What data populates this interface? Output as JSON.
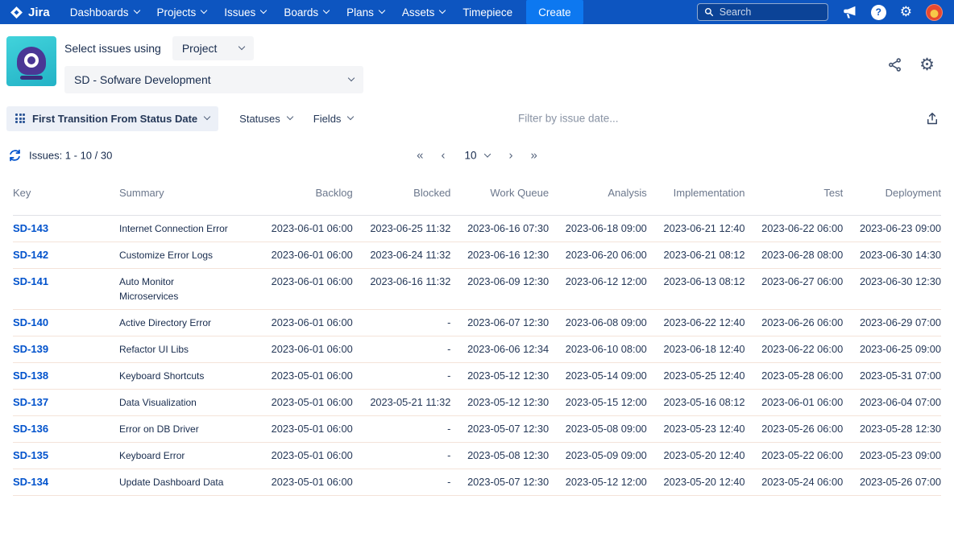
{
  "nav": {
    "brand": "Jira",
    "items": [
      {
        "label": "Dashboards",
        "chevron": true
      },
      {
        "label": "Projects",
        "chevron": true
      },
      {
        "label": "Issues",
        "chevron": true
      },
      {
        "label": "Boards",
        "chevron": true
      },
      {
        "label": "Plans",
        "chevron": true
      },
      {
        "label": "Assets",
        "chevron": true
      },
      {
        "label": "Timepiece",
        "chevron": false
      }
    ],
    "create_label": "Create",
    "search_placeholder": "Search"
  },
  "gadget_header": {
    "select_issues_label": "Select issues using",
    "issue_source_value": "Project",
    "project_value": "SD - Sofware Development"
  },
  "toolbar": {
    "column_mode_label": "First Transition From Status Date",
    "statuses_label": "Statuses",
    "fields_label": "Fields",
    "filter_placeholder": "Filter by issue date..."
  },
  "pagination": {
    "issues_summary": "Issues: 1 - 10 / 30",
    "page_size": "10",
    "first_label": "«",
    "prev_label": "‹",
    "next_label": "›",
    "last_label": "»"
  },
  "table": {
    "columns": [
      "Key",
      "Summary",
      "Backlog",
      "Blocked",
      "Work Queue",
      "Analysis",
      "Implementation",
      "Test",
      "Deployment"
    ],
    "rows": [
      {
        "key": "SD-143",
        "summary": "Internet Connection Error",
        "dates": [
          "2023-06-01 06:00",
          "2023-06-25 11:32",
          "2023-06-16 07:30",
          "2023-06-18 09:00",
          "2023-06-21 12:40",
          "2023-06-22 06:00",
          "2023-06-23 09:00"
        ]
      },
      {
        "key": "SD-142",
        "summary": "Customize Error Logs",
        "dates": [
          "2023-06-01 06:00",
          "2023-06-24 11:32",
          "2023-06-16 12:30",
          "2023-06-20 06:00",
          "2023-06-21 08:12",
          "2023-06-28 08:00",
          "2023-06-30 14:30"
        ]
      },
      {
        "key": "SD-141",
        "summary": "Auto Monitor Microservices",
        "dates": [
          "2023-06-01 06:00",
          "2023-06-16 11:32",
          "2023-06-09 12:30",
          "2023-06-12 12:00",
          "2023-06-13 08:12",
          "2023-06-27 06:00",
          "2023-06-30 12:30"
        ]
      },
      {
        "key": "SD-140",
        "summary": "Active Directory Error",
        "dates": [
          "2023-06-01 06:00",
          "-",
          "2023-06-07 12:30",
          "2023-06-08 09:00",
          "2023-06-22 12:40",
          "2023-06-26 06:00",
          "2023-06-29 07:00"
        ]
      },
      {
        "key": "SD-139",
        "summary": "Refactor UI Libs",
        "dates": [
          "2023-06-01 06:00",
          "-",
          "2023-06-06 12:34",
          "2023-06-10 08:00",
          "2023-06-18 12:40",
          "2023-06-22 06:00",
          "2023-06-25 09:00"
        ]
      },
      {
        "key": "SD-138",
        "summary": "Keyboard Shortcuts",
        "dates": [
          "2023-05-01 06:00",
          "-",
          "2023-05-12 12:30",
          "2023-05-14 09:00",
          "2023-05-25 12:40",
          "2023-05-28 06:00",
          "2023-05-31 07:00"
        ]
      },
      {
        "key": "SD-137",
        "summary": "Data Visualization",
        "dates": [
          "2023-05-01 06:00",
          "2023-05-21 11:32",
          "2023-05-12 12:30",
          "2023-05-15 12:00",
          "2023-05-16 08:12",
          "2023-06-01 06:00",
          "2023-06-04 07:00"
        ]
      },
      {
        "key": "SD-136",
        "summary": "Error on DB Driver",
        "dates": [
          "2023-05-01 06:00",
          "-",
          "2023-05-07 12:30",
          "2023-05-08 09:00",
          "2023-05-23 12:40",
          "2023-05-26 06:00",
          "2023-05-28 12:30"
        ]
      },
      {
        "key": "SD-135",
        "summary": "Keyboard Error",
        "dates": [
          "2023-05-01 06:00",
          "-",
          "2023-05-08 12:30",
          "2023-05-09 09:00",
          "2023-05-20 12:40",
          "2023-05-22 06:00",
          "2023-05-23 09:00"
        ]
      },
      {
        "key": "SD-134",
        "summary": "Update Dashboard Data",
        "dates": [
          "2023-05-01 06:00",
          "-",
          "2023-05-07 12:30",
          "2023-05-12 12:00",
          "2023-05-20 12:40",
          "2023-05-24 06:00",
          "2023-05-26 07:00"
        ]
      }
    ]
  },
  "colors": {
    "nav_bg": "#0d55c0",
    "create_bg": "#0d78f0",
    "link_blue": "#0052CC",
    "row_divider": "#F4E3D9",
    "pill_bg": "#ECF0F7"
  }
}
